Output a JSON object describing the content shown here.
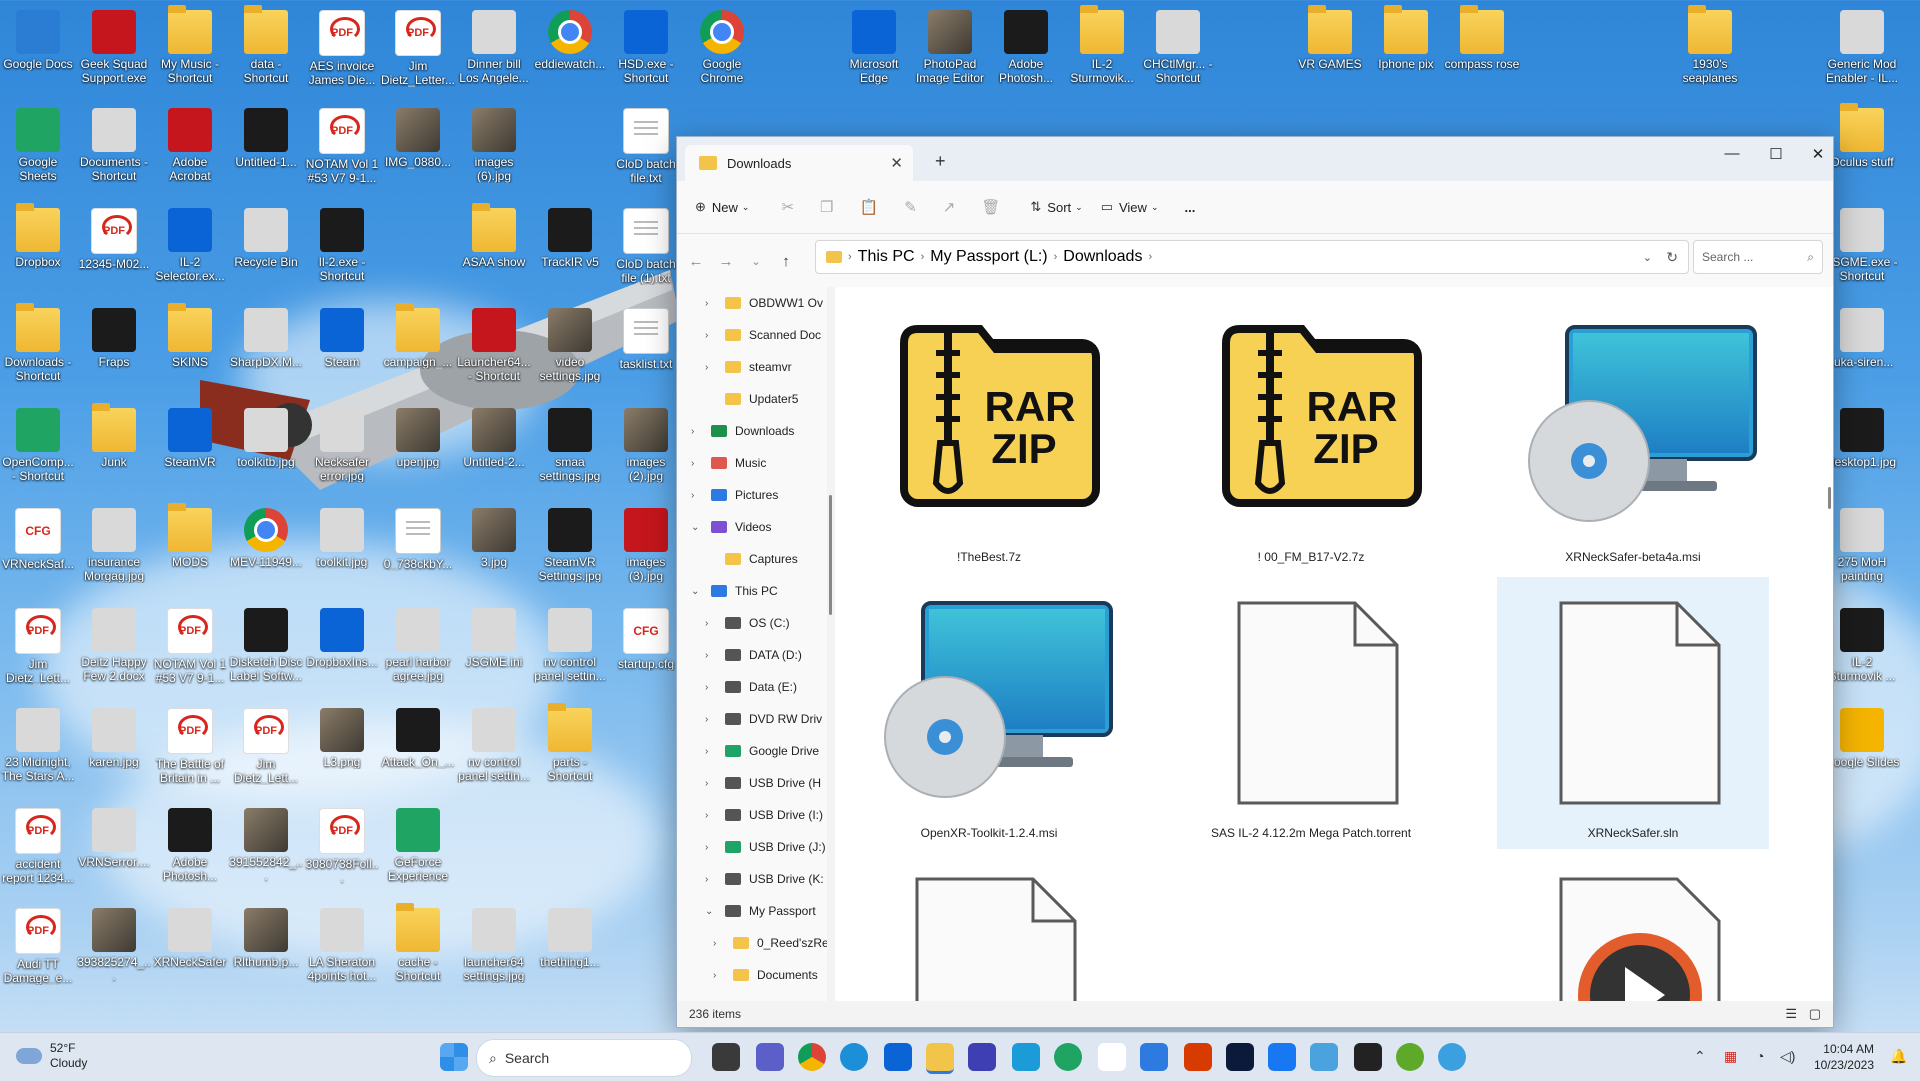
{
  "desktop": {
    "icons": [
      {
        "label": "Google Docs",
        "icon": "docs-icon",
        "cls": "doc"
      },
      {
        "label": "Geek Squad Support.exe",
        "icon": "geek-squad-icon",
        "cls": "red"
      },
      {
        "label": "My Music - Shortcut",
        "icon": "folder-icon",
        "cls": "folder"
      },
      {
        "label": "data - Shortcut",
        "icon": "folder-icon",
        "cls": "folder"
      },
      {
        "label": "AES invoice James Die...",
        "icon": "pdf-icon",
        "cls": "pdf"
      },
      {
        "label": "Jim Dietz_Letter...",
        "icon": "pdf-icon",
        "cls": "pdf"
      },
      {
        "label": "Dinner bill Los Angele...",
        "icon": "image-icon",
        "cls": "gray"
      },
      {
        "label": "eddiewatch...",
        "icon": "chrome-icon",
        "cls": "chrome"
      },
      {
        "label": "HSD.exe - Shortcut",
        "icon": "app-icon",
        "cls": "blue"
      },
      {
        "label": "Google Chrome",
        "icon": "chrome-icon",
        "cls": "chrome"
      },
      {
        "label": "Microsoft Edge",
        "icon": "edge-icon",
        "cls": "blue"
      },
      {
        "label": "PhotoPad Image Editor",
        "icon": "photopad-icon",
        "cls": "img"
      },
      {
        "label": "Adobe Photosh...",
        "icon": "photoshop-icon",
        "cls": "app"
      },
      {
        "label": "IL-2 Sturmovik...",
        "icon": "folder-icon",
        "cls": "folder"
      },
      {
        "label": "CHCtlMgr... - Shortcut",
        "icon": "app-icon",
        "cls": "gray"
      },
      {
        "label": "VR GAMES",
        "icon": "folder-icon",
        "cls": "folder"
      },
      {
        "label": "Iphone pix",
        "icon": "folder-icon",
        "cls": "folder"
      },
      {
        "label": "compass rose",
        "icon": "folder-icon",
        "cls": "folder"
      },
      {
        "label": "1930's seaplanes",
        "icon": "folder-icon",
        "cls": "folder"
      },
      {
        "label": "Generic Mod Enabler - IL...",
        "icon": "gme-icon",
        "cls": "gray"
      },
      {
        "label": "Google Sheets",
        "icon": "sheets-icon",
        "cls": "sheet"
      },
      {
        "label": "Documents - Shortcut",
        "icon": "documents-icon",
        "cls": "gray"
      },
      {
        "label": "Adobe Acrobat",
        "icon": "acrobat-icon",
        "cls": "red"
      },
      {
        "label": "Untitled-1...",
        "icon": "image-icon",
        "cls": "app"
      },
      {
        "label": "NOTAM Vol 1 #53 V7 9-1...",
        "icon": "pdf-icon",
        "cls": "pdf"
      },
      {
        "label": "IMG_0880...",
        "icon": "image-icon",
        "cls": "img"
      },
      {
        "label": "images (6).jpg",
        "icon": "image-icon",
        "cls": "img"
      },
      {
        "label": "CloD batch file.txt",
        "icon": "text-icon",
        "cls": "txt"
      },
      {
        "label": "Oculus stuff",
        "icon": "folder-icon",
        "cls": "folder"
      },
      {
        "label": "Dropbox",
        "icon": "folder-icon",
        "cls": "folder"
      },
      {
        "label": "12345-M02...",
        "icon": "pdf-icon",
        "cls": "pdf"
      },
      {
        "label": "IL-2 Selector.ex...",
        "icon": "il2-selector-icon",
        "cls": "blue"
      },
      {
        "label": "Recycle Bin",
        "icon": "recycle-bin-icon",
        "cls": "gray"
      },
      {
        "label": "Il-2.exe - Shortcut",
        "icon": "il2-icon",
        "cls": "app"
      },
      {
        "label": "ASAA show",
        "icon": "folder-icon",
        "cls": "folder"
      },
      {
        "label": "TrackIR v5",
        "icon": "trackir-icon",
        "cls": "app"
      },
      {
        "label": "CloD batch file (1).txt",
        "icon": "text-icon",
        "cls": "txt"
      },
      {
        "label": "JSGME.exe - Shortcut",
        "icon": "gme-icon",
        "cls": "gray"
      },
      {
        "label": "Downloads - Shortcut",
        "icon": "folder-icon",
        "cls": "folder"
      },
      {
        "label": "Fraps",
        "icon": "fraps-icon",
        "cls": "app"
      },
      {
        "label": "SKINS",
        "icon": "folder-icon",
        "cls": "folder"
      },
      {
        "label": "SharpDX.M...",
        "icon": "settings-file-icon",
        "cls": "gray"
      },
      {
        "label": "Steam",
        "icon": "steam-icon",
        "cls": "blue"
      },
      {
        "label": "campaign_...",
        "icon": "folder-icon",
        "cls": "folder"
      },
      {
        "label": "Launcher64... - Shortcut",
        "icon": "launcher-icon",
        "cls": "red"
      },
      {
        "label": "video settings.jpg",
        "icon": "image-icon",
        "cls": "img"
      },
      {
        "label": "tasklist.txt",
        "icon": "text-icon",
        "cls": "txt"
      },
      {
        "label": "tuka-siren...",
        "icon": "media-icon",
        "cls": "gray"
      },
      {
        "label": "OpenComp... - Shortcut",
        "icon": "opencomposite-icon",
        "cls": "sheet"
      },
      {
        "label": "Junk",
        "icon": "folder-icon",
        "cls": "folder"
      },
      {
        "label": "SteamVR",
        "icon": "steamvr-icon",
        "cls": "blue"
      },
      {
        "label": "toolkitb.jpg",
        "icon": "image-icon",
        "cls": "gray"
      },
      {
        "label": "Necksafer error.jpg",
        "icon": "image-icon",
        "cls": "gray"
      },
      {
        "label": "upenjpg",
        "icon": "image-icon",
        "cls": "img"
      },
      {
        "label": "Untitled-2...",
        "icon": "image-icon",
        "cls": "img"
      },
      {
        "label": "smaa settings.jpg",
        "icon": "image-icon",
        "cls": "app"
      },
      {
        "label": "images (2).jpg",
        "icon": "image-icon",
        "cls": "img"
      },
      {
        "label": "desktop1.jpg",
        "icon": "image-icon",
        "cls": "app"
      },
      {
        "label": "VRNeckSaf...",
        "icon": "cfg-icon",
        "cls": "cfg"
      },
      {
        "label": "insurance Morgag.jpg",
        "icon": "image-icon",
        "cls": "gray"
      },
      {
        "label": "MODS",
        "icon": "folder-icon",
        "cls": "folder"
      },
      {
        "label": "MEV-11949...",
        "icon": "chrome-icon",
        "cls": "chrome"
      },
      {
        "label": "toolkit.jpg",
        "icon": "image-icon",
        "cls": "gray"
      },
      {
        "label": "0_738ckbY...",
        "icon": "text-icon",
        "cls": "txt"
      },
      {
        "label": "3.jpg",
        "icon": "image-icon",
        "cls": "img"
      },
      {
        "label": "SteamVR Settings.jpg",
        "icon": "image-icon",
        "cls": "app"
      },
      {
        "label": "images (3).jpg",
        "icon": "image-icon",
        "cls": "red"
      },
      {
        "label": "275 MoH painting",
        "icon": "image-icon",
        "cls": "gray"
      },
      {
        "label": "Jim Dietz_Lett...",
        "icon": "pdf-icon",
        "cls": "pdf"
      },
      {
        "label": "Deitz Happy Few 2.docx",
        "icon": "word-icon",
        "cls": "gray"
      },
      {
        "label": "NOTAM Vol 1 #53 V7 9-1...",
        "icon": "pdf-icon",
        "cls": "pdf"
      },
      {
        "label": "Disketch Disc Label Softw...",
        "icon": "disketch-icon",
        "cls": "app"
      },
      {
        "label": "DropboxIns...",
        "icon": "dropbox-icon",
        "cls": "blue"
      },
      {
        "label": "pearl harbor agree.jpg",
        "icon": "image-icon",
        "cls": "gray"
      },
      {
        "label": "JSGME.ini",
        "icon": "settings-file-icon",
        "cls": "gray"
      },
      {
        "label": "nv control panel settin...",
        "icon": "image-icon",
        "cls": "gray"
      },
      {
        "label": "startup.cfg",
        "icon": "cfg-icon",
        "cls": "cfg"
      },
      {
        "label": "IL-2 Sturmovik ...",
        "icon": "il2-icon",
        "cls": "app"
      },
      {
        "label": "23 Midnight, The Stars A...",
        "icon": "media-icon",
        "cls": "gray"
      },
      {
        "label": "karen.jpg",
        "icon": "image-icon",
        "cls": "gray"
      },
      {
        "label": "The Battle of Britain in ...",
        "icon": "pdf-icon",
        "cls": "pdf"
      },
      {
        "label": "Jim Dietz_Lett...",
        "icon": "pdf-icon",
        "cls": "pdf"
      },
      {
        "label": "L3.png",
        "icon": "image-icon",
        "cls": "img"
      },
      {
        "label": "Attack_On_...",
        "icon": "image-icon",
        "cls": "app"
      },
      {
        "label": "nv control panel settin...",
        "icon": "image-icon",
        "cls": "gray"
      },
      {
        "label": "parts - Shortcut",
        "icon": "folder-icon",
        "cls": "folder"
      },
      {
        "label": "Google Slides",
        "icon": "slides-icon",
        "cls": "slides"
      },
      {
        "label": "accident report 1234...",
        "icon": "pdf-icon",
        "cls": "pdf"
      },
      {
        "label": "VRNSerror....",
        "icon": "image-icon",
        "cls": "gray"
      },
      {
        "label": "Adobe Photosh...",
        "icon": "photoshop-icon",
        "cls": "app"
      },
      {
        "label": "391552842_...",
        "icon": "image-icon",
        "cls": "img"
      },
      {
        "label": "3080738Foll...",
        "icon": "pdf-icon",
        "cls": "pdf"
      },
      {
        "label": "GeForce Experience",
        "icon": "geforce-icon",
        "cls": "sheet"
      },
      {
        "label": "Audi TT Damage_e...",
        "icon": "pdf-icon",
        "cls": "pdf"
      },
      {
        "label": "393825274_...",
        "icon": "image-icon",
        "cls": "img"
      },
      {
        "label": "XRNeckSafer",
        "icon": "xrnecksafer-icon",
        "cls": "gray"
      },
      {
        "label": "Rlthumb.p...",
        "icon": "image-icon",
        "cls": "img"
      },
      {
        "label": "LA Sheraton 4points hot...",
        "icon": "image-icon",
        "cls": "gray"
      },
      {
        "label": "cache - Shortcut",
        "icon": "folder-icon",
        "cls": "folder"
      },
      {
        "label": "launcher64 settings.jpg",
        "icon": "image-icon",
        "cls": "gray"
      },
      {
        "label": "thething1...",
        "icon": "wav-icon",
        "cls": "gray"
      }
    ]
  },
  "explorer": {
    "tab_title": "Downloads",
    "toolbar": {
      "new": "New",
      "sort": "Sort",
      "view": "View",
      "more": "..."
    },
    "breadcrumb": [
      "This PC",
      "My Passport (L:)",
      "Downloads"
    ],
    "search_placeholder": "Search ...",
    "nav": [
      {
        "label": "OBDWW1 Ov",
        "color": "#f3c44a",
        "indent": 0,
        "chev": "›"
      },
      {
        "label": "Scanned Doc",
        "color": "#f3c44a",
        "indent": 0,
        "chev": "›"
      },
      {
        "label": "steamvr",
        "color": "#f3c44a",
        "indent": 0,
        "chev": "›"
      },
      {
        "label": "Updater5",
        "color": "#f3c44a",
        "indent": 0,
        "chev": ""
      },
      {
        "label": "Downloads",
        "color": "#1f8f4e",
        "indent": -1,
        "chev": "›"
      },
      {
        "label": "Music",
        "color": "#e0574b",
        "indent": -1,
        "chev": "›"
      },
      {
        "label": "Pictures",
        "color": "#2d7be0",
        "indent": -1,
        "chev": "›"
      },
      {
        "label": "Videos",
        "color": "#7d4fd1",
        "indent": -1,
        "chev": "⌄"
      },
      {
        "label": "Captures",
        "color": "#f3c44a",
        "indent": 0,
        "chev": ""
      },
      {
        "label": "This PC",
        "color": "#2d7be0",
        "indent": -1,
        "chev": "⌄"
      },
      {
        "label": "OS (C:)",
        "color": "#555",
        "indent": 0,
        "chev": "›"
      },
      {
        "label": "DATA (D:)",
        "color": "#555",
        "indent": 0,
        "chev": "›"
      },
      {
        "label": "Data (E:)",
        "color": "#555",
        "indent": 0,
        "chev": "›"
      },
      {
        "label": "DVD RW Driv",
        "color": "#555",
        "indent": 0,
        "chev": "›"
      },
      {
        "label": "Google Drive",
        "color": "#1fa463",
        "indent": 0,
        "chev": "›"
      },
      {
        "label": "USB Drive (H",
        "color": "#555",
        "indent": 0,
        "chev": "›"
      },
      {
        "label": "USB Drive (I:)",
        "color": "#555",
        "indent": 0,
        "chev": "›"
      },
      {
        "label": "USB Drive (J:)",
        "color": "#1fa463",
        "indent": 0,
        "chev": "›"
      },
      {
        "label": "USB Drive (K:",
        "color": "#555",
        "indent": 0,
        "chev": "›"
      },
      {
        "label": "My Passport",
        "color": "#555",
        "indent": 0,
        "chev": "⌄"
      },
      {
        "label": "0_Reed'szRe",
        "color": "#f3c44a",
        "indent": 1,
        "chev": "›"
      },
      {
        "label": "Documents",
        "color": "#f3c44a",
        "indent": 1,
        "chev": "›"
      }
    ],
    "files": [
      {
        "name": "!TheBest.7z",
        "type": "zip"
      },
      {
        "name": "!     00_FM_B17-V2.7z",
        "type": "zip"
      },
      {
        "name": "XRNeckSafer-beta4a.msi",
        "type": "msi"
      },
      {
        "name": "OpenXR-Toolkit-1.2.4.msi",
        "type": "msi"
      },
      {
        "name": "SAS IL-2 4.12.2m Mega Patch.torrent",
        "type": "blank"
      },
      {
        "name": "XRNeckSafer.sln",
        "type": "blank"
      },
      {
        "name": "",
        "type": "blank"
      },
      {
        "name": "",
        "type": "none"
      },
      {
        "name": "",
        "type": "media"
      }
    ],
    "zip_label": [
      "RAR",
      "ZIP"
    ],
    "status": "236 items"
  },
  "taskbar": {
    "temp": "52°F",
    "weather": "Cloudy",
    "search": "Search",
    "time": "10:04 AM",
    "date": "10/23/2023"
  }
}
